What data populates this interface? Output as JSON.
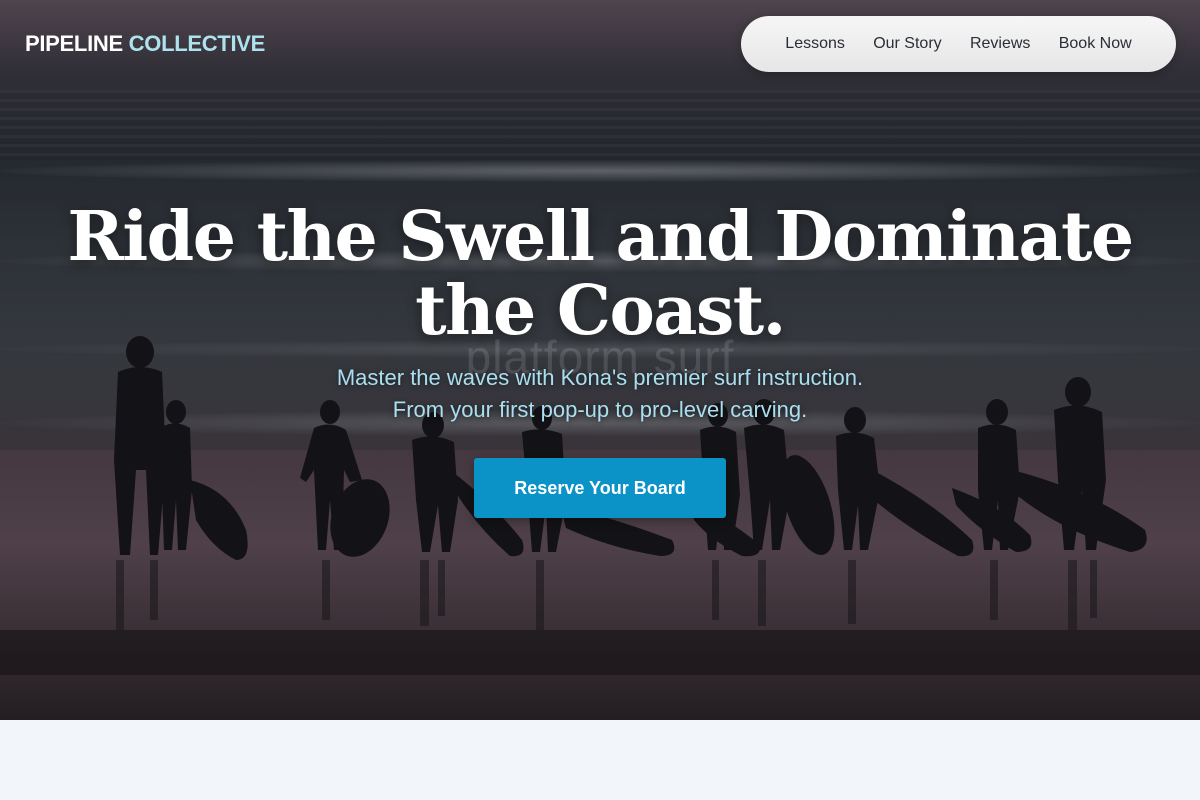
{
  "brand": {
    "primary": "PIPELINE",
    "accent": "COLLECTIVE"
  },
  "nav": {
    "items": [
      {
        "label": "Lessons"
      },
      {
        "label": "Our Story"
      },
      {
        "label": "Reviews"
      },
      {
        "label": "Book Now"
      }
    ]
  },
  "hero": {
    "headline": "Ride the Swell and Dominate the Coast.",
    "watermark": "platform surf",
    "subline_1": "Master the waves with Kona's premier surf instruction.",
    "subline_2": "From your first pop-up to pro-level carving.",
    "cta_label": "Reserve Your Board"
  },
  "colors": {
    "brand_accent": "#aee3ee",
    "cta_background": "#0b93c8",
    "subline_text": "#a9dff0",
    "page_background": "#f2f5f9"
  }
}
